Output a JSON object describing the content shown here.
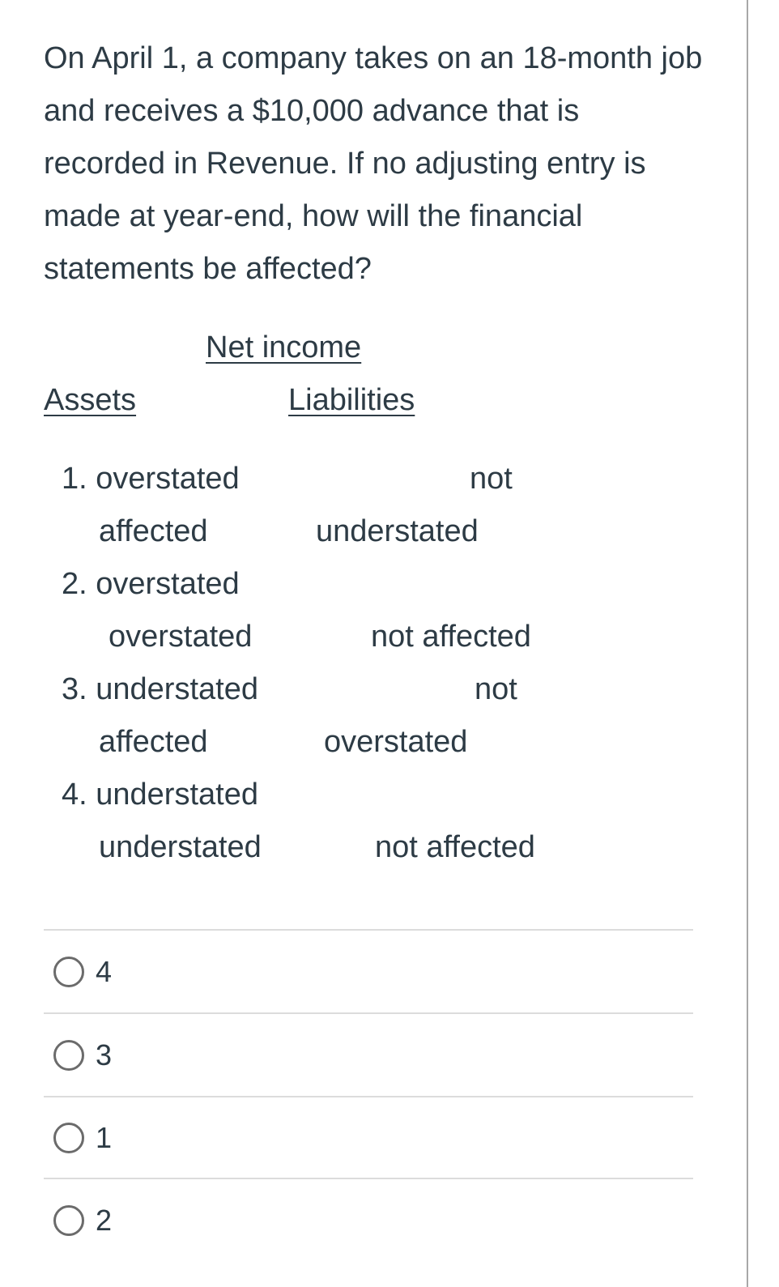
{
  "question": "On April 1, a company takes on an 18-month job and receives a $10,000 advance that is recorded in Revenue. If no adjusting entry is made at year-end, how will the financial statements be affected?",
  "headers": {
    "net_income": "Net income",
    "assets": "Assets",
    "liabilities": "Liabilities"
  },
  "rows": [
    {
      "line1_left": "1. overstated",
      "line1_right": "not",
      "line2_left": "affected",
      "line2_right": "understated"
    },
    {
      "line1_left": "2. overstated",
      "line1_right": "",
      "line2_left": "overstated",
      "line2_right": "not affected"
    },
    {
      "line1_left": "3. understated",
      "line1_right": "not",
      "line2_left": "affected",
      "line2_right": "overstated"
    },
    {
      "line1_left": "4. understated",
      "line1_right": "",
      "line2_left": "understated",
      "line2_right": "not affected"
    }
  ],
  "options": [
    {
      "label": "4",
      "selected": false
    },
    {
      "label": "3",
      "selected": false
    },
    {
      "label": "1",
      "selected": false
    },
    {
      "label": "2",
      "selected": false
    }
  ]
}
